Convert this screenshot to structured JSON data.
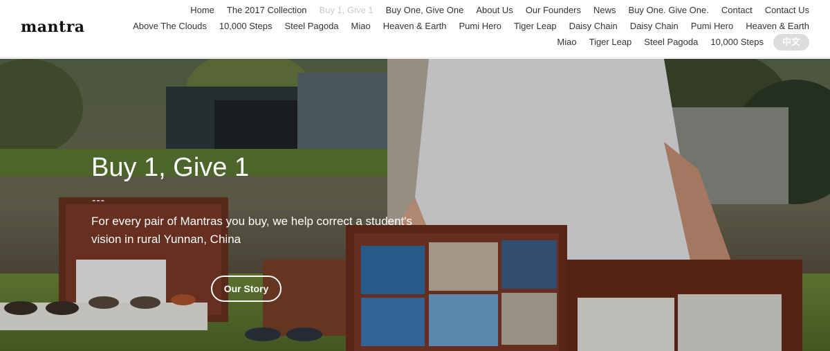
{
  "brand": {
    "logo": "mantra"
  },
  "nav": {
    "row1": [
      {
        "label": "Home",
        "active": false
      },
      {
        "label": "The 2017 Collection",
        "active": false
      },
      {
        "label": "Buy 1, Give 1",
        "active": true
      },
      {
        "label": "Buy One, Give One",
        "active": false
      },
      {
        "label": "About Us",
        "active": false
      },
      {
        "label": "Our Founders",
        "active": false
      },
      {
        "label": "News",
        "active": false
      },
      {
        "label": "Buy One. Give One.",
        "active": false
      },
      {
        "label": "Contact",
        "active": false
      },
      {
        "label": "Contact Us",
        "active": false
      }
    ],
    "row2": [
      {
        "label": "Above The Clouds"
      },
      {
        "label": "10,000 Steps"
      },
      {
        "label": "Steel Pagoda"
      },
      {
        "label": "Miao"
      },
      {
        "label": "Heaven & Earth"
      },
      {
        "label": "Pumi Hero"
      },
      {
        "label": "Tiger Leap"
      },
      {
        "label": "Daisy Chain"
      },
      {
        "label": "Daisy Chain"
      },
      {
        "label": "Pumi Hero"
      },
      {
        "label": "Heaven & Earth"
      }
    ],
    "row3": [
      {
        "label": "Miao"
      },
      {
        "label": "Tiger Leap"
      },
      {
        "label": "Steel Pagoda"
      },
      {
        "label": "10,000 Steps"
      }
    ],
    "language_button": "中文"
  },
  "hero": {
    "title": "Buy 1, Give 1",
    "separator": "---",
    "description": "For every pair of Mantras you buy, we help correct a student's vision in rural Yunnan, China",
    "button_label": "Our Story"
  }
}
